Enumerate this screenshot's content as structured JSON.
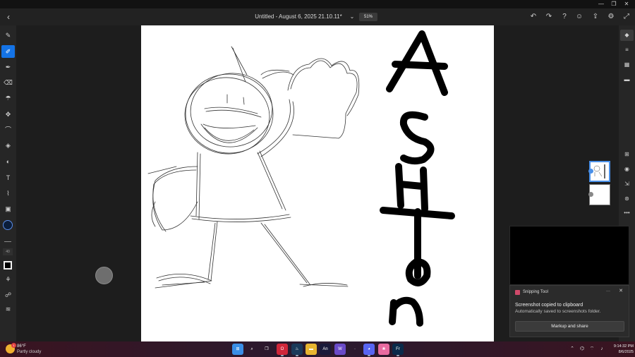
{
  "window": {
    "minimize_glyph": "—",
    "maximize_glyph": "❐",
    "close_glyph": "✕"
  },
  "header": {
    "back_glyph": "‹",
    "title": "Untitled - August 6, 2025 21.10.11*",
    "chevron_glyph": "⌄",
    "zoom": "51%",
    "buttons": [
      {
        "name": "undo-icon",
        "glyph": "↶"
      },
      {
        "name": "redo-icon",
        "glyph": "↷"
      },
      {
        "name": "help-icon",
        "glyph": "?"
      },
      {
        "name": "account-icon",
        "glyph": "☺"
      },
      {
        "name": "share-icon",
        "glyph": "⇪"
      },
      {
        "name": "settings-icon",
        "glyph": "⚙"
      },
      {
        "name": "fullscreen-icon",
        "glyph": "⤢"
      }
    ]
  },
  "left_tools": [
    {
      "name": "brush-tool-icon",
      "glyph": "✎",
      "active": false
    },
    {
      "name": "pencil-brush-tool-icon",
      "glyph": "✐",
      "active": true
    },
    {
      "name": "fill-brush-tool-icon",
      "glyph": "✒",
      "active": false
    },
    {
      "name": "eraser-tool-icon",
      "glyph": "⌫",
      "active": false
    },
    {
      "name": "smudge-tool-icon",
      "glyph": "☂",
      "active": false
    },
    {
      "name": "transform-tool-icon",
      "glyph": "✥",
      "active": false
    },
    {
      "name": "lasso-tool-icon",
      "glyph": "⌒",
      "active": false
    },
    {
      "name": "paint-bucket-icon",
      "glyph": "◈",
      "active": false
    },
    {
      "name": "shape-tool-icon",
      "glyph": "◐",
      "active": false
    },
    {
      "name": "text-tool-icon",
      "glyph": "T",
      "active": false
    },
    {
      "name": "eyedropper-icon",
      "glyph": "⌇",
      "active": false
    },
    {
      "name": "image-import-icon",
      "glyph": "▣",
      "active": false
    }
  ],
  "brush_settings": {
    "size": "40",
    "color": "#0b1d3a"
  },
  "bottom_tools": [
    {
      "name": "blend-icon",
      "glyph": "⚘"
    },
    {
      "name": "stylus-settings-icon",
      "glyph": "☍"
    },
    {
      "name": "pressure-icon",
      "glyph": "≋"
    }
  ],
  "right_tools": [
    {
      "name": "layers-icon",
      "glyph": "◆",
      "active": true
    },
    {
      "name": "adjustments-icon",
      "glyph": "≡",
      "active": false
    },
    {
      "name": "grid-icon",
      "glyph": "▦",
      "active": false
    },
    {
      "name": "comments-icon",
      "glyph": "▬",
      "active": false
    },
    {
      "name": "add-layer-icon",
      "glyph": "⊞",
      "active": false
    },
    {
      "name": "visibility-icon",
      "glyph": "◉",
      "active": false
    },
    {
      "name": "merge-layer-icon",
      "glyph": "⇲",
      "active": false
    },
    {
      "name": "layer-properties-icon",
      "glyph": "⊛",
      "active": false
    },
    {
      "name": "more-options-icon",
      "glyph": "•••",
      "active": false
    }
  ],
  "layers": [
    {
      "name": "layer-1",
      "active": true
    },
    {
      "name": "layer-2",
      "active": false
    }
  ],
  "artwork": {
    "text_letters": [
      "A",
      "S",
      "H",
      "T",
      "o",
      "n"
    ]
  },
  "toast": {
    "app_name": "Snipping Tool",
    "more_glyph": "···",
    "close_glyph": "✕",
    "title": "Screenshot copied to clipboard",
    "body": "Automatically saved to screenshots folder.",
    "action_label": "Markup and share"
  },
  "taskbar": {
    "weather_temp": "86°F",
    "weather_condition": "Partly cloudy",
    "weather_badge": "1",
    "apps": [
      {
        "name": "start-icon",
        "glyph": "⊞",
        "color": "#3a8ee6",
        "open": false
      },
      {
        "name": "search-icon",
        "glyph": "⌕",
        "color": "transparent",
        "open": false
      },
      {
        "name": "task-view-icon",
        "glyph": "❐",
        "color": "transparent",
        "open": false
      },
      {
        "name": "opera-icon",
        "glyph": "O",
        "color": "#d0263a",
        "open": true
      },
      {
        "name": "steam-icon",
        "glyph": "♨",
        "color": "#1b3a5a",
        "open": true
      },
      {
        "name": "file-explorer-icon",
        "glyph": "▬",
        "color": "#e8b530",
        "open": false
      },
      {
        "name": "animate-icon",
        "glyph": "An",
        "color": "#1a1a3a",
        "open": false
      },
      {
        "name": "wacom-icon",
        "glyph": "W",
        "color": "#6a4ac8",
        "open": false
      },
      {
        "name": "misc-app-icon",
        "glyph": "·",
        "color": "transparent",
        "open": false
      },
      {
        "name": "discord-icon",
        "glyph": "◕",
        "color": "#5865f2",
        "open": true
      },
      {
        "name": "photos-icon",
        "glyph": "❀",
        "color": "#e86aa0",
        "open": false
      },
      {
        "name": "fresco-icon",
        "glyph": "Fr",
        "color": "#0a2a4a",
        "open": true
      }
    ],
    "tray": [
      {
        "name": "tray-overflow-icon",
        "glyph": "⌃"
      },
      {
        "name": "network-tray-icon",
        "glyph": "⌬"
      },
      {
        "name": "wifi-tray-icon",
        "glyph": "⌔"
      },
      {
        "name": "volume-tray-icon",
        "glyph": "♪"
      }
    ],
    "time": "9:14:32 PM",
    "date": "8/6/2025"
  }
}
